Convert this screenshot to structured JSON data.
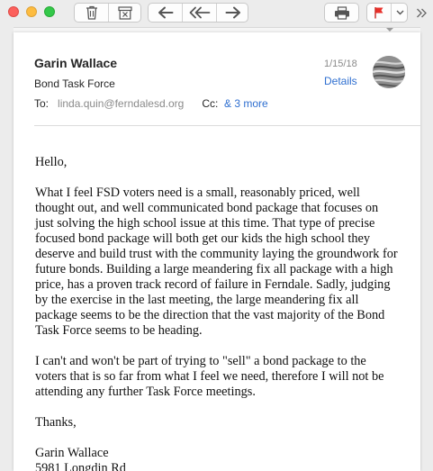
{
  "toolbar": {
    "buttons": [
      {
        "name": "delete",
        "icon": "trash-icon"
      },
      {
        "name": "archive",
        "icon": "archive-icon"
      },
      {
        "name": "reply",
        "icon": "reply-icon"
      },
      {
        "name": "reply-all",
        "icon": "reply-all-icon"
      },
      {
        "name": "forward",
        "icon": "forward-icon"
      },
      {
        "name": "print",
        "icon": "printer-icon"
      },
      {
        "name": "flag",
        "icon": "flag-icon"
      },
      {
        "name": "flag-menu",
        "icon": "chevron-down-icon"
      },
      {
        "name": "more",
        "icon": "double-chevron-right-icon"
      }
    ],
    "flag_color": "#e8302a"
  },
  "message": {
    "sender": "Garin Wallace",
    "subject": "Bond Task Force",
    "to_label": "To:",
    "to_address": "linda.quin@ferndalesd.org",
    "cc_label": "Cc:",
    "cc_more": "& 3 more",
    "date": "1/15/18",
    "details_label": "Details",
    "link_color": "#2f6fd0"
  },
  "body": {
    "greeting": "Hello,",
    "paragraph_1": "What I feel FSD voters need is a small, reasonably priced, well thought out, and well communicated bond package that focuses on just solving the high school issue at this time.  That type of precise focused bond package will both get our kids the high school they deserve and build trust with the community laying the groundwork for future bonds.   Building a large meandering fix all package with a high price, has a proven track record of failure in Ferndale.  Sadly, judging by the exercise in the last meeting,  the large meandering fix all package seems to be the direction that the vast majority of the Bond Task Force seems to be heading.",
    "paragraph_2": "I can't and won't be part of trying to \"sell\" a bond package to the voters that is so far from what I feel we need, therefore I will not be attending any further Task Force meetings.",
    "closing": "Thanks,",
    "signature_name": "Garin Wallace",
    "signature_address": "5981 Longdin Rd"
  }
}
